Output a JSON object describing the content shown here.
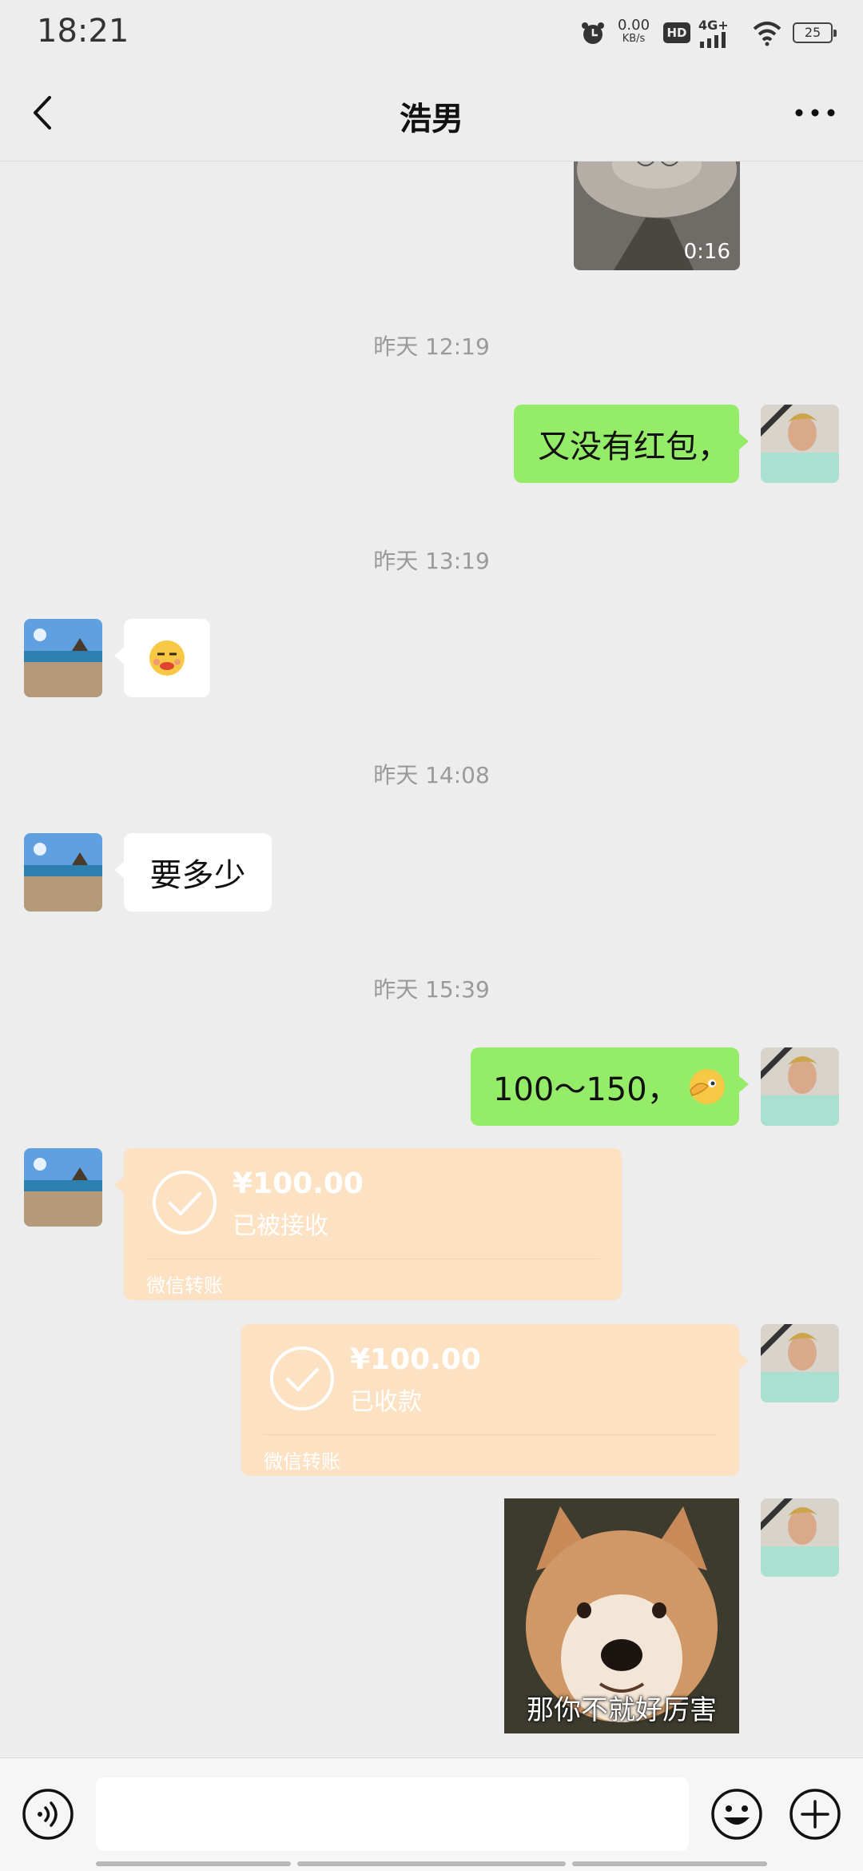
{
  "status_bar": {
    "time": "18:21",
    "net_speed_value": "0.00",
    "net_speed_unit": "KB/s",
    "hd_label": "HD",
    "signal_label": "4G+",
    "battery": "25",
    "icons": [
      "alarm-icon",
      "hd-icon",
      "signal-4g-icon",
      "wifi-icon",
      "battery-icon"
    ]
  },
  "nav": {
    "title": "浩男",
    "back_icon": "chevron-left-icon",
    "more_icon": "ellipsis-icon"
  },
  "video": {
    "duration": "0:16"
  },
  "messages": {
    "ts1": "昨天 12:19",
    "m1": "又没有红包，",
    "ts2": "昨天 13:19",
    "m2_icon": "smirk-emoji-icon",
    "ts3": "昨天 14:08",
    "m3": "要多少",
    "ts4": "昨天 15:39",
    "m4": "100～150，",
    "m4_icon": "facepalm-emoji-icon"
  },
  "transfers": {
    "received": {
      "amount": "¥100.00",
      "status": "已被接收",
      "footer": "微信转账"
    },
    "sent": {
      "amount": "¥100.00",
      "status": "已收款",
      "footer": "微信转账"
    }
  },
  "sticker": {
    "caption": "那你不就好厉害"
  },
  "input_bar": {
    "placeholder": "",
    "voice_icon": "voice-icon",
    "emoji_icon": "emoji-icon",
    "plus_icon": "plus-icon"
  },
  "colors": {
    "background": "#ededed",
    "bubble_self": "#95ec69",
    "bubble_other": "#ffffff",
    "transfer_accepted": "#fde1c3"
  }
}
